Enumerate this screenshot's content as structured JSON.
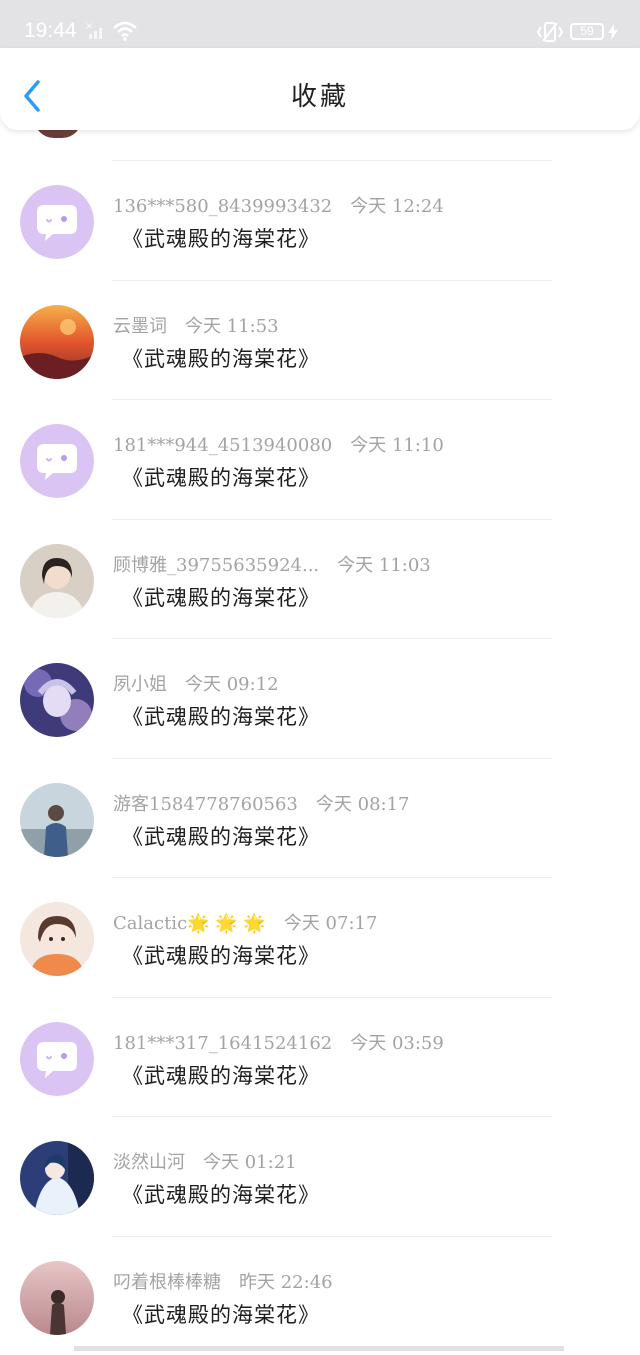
{
  "status_bar": {
    "time": "19:44",
    "battery": "59"
  },
  "header": {
    "title": "收藏"
  },
  "colors": {
    "accent": "#2a9df4",
    "default_avatar": "#d9c4f3",
    "default_avatar_icon": "#ffffff"
  },
  "items": [
    {
      "user": "136***580_8439993432",
      "time": "今天 12:24",
      "comment": "《武魂殿的海棠花》",
      "avatar": "default"
    },
    {
      "user": "云墨词",
      "time": "今天 11:53",
      "comment": "《武魂殿的海棠花》",
      "avatar": "sunset"
    },
    {
      "user": "181***944_4513940080",
      "time": "今天 11:10",
      "comment": "《武魂殿的海棠花》",
      "avatar": "default"
    },
    {
      "user": "顾博雅_39755635924...",
      "time": "今天 11:03",
      "comment": "《武魂殿的海棠花》",
      "avatar": "girl-white"
    },
    {
      "user": "夙小姐",
      "time": "今天 09:12",
      "comment": "《武魂殿的海棠花》",
      "avatar": "anime-purple"
    },
    {
      "user": "游客1584778760563",
      "time": "今天 08:17",
      "comment": "《武魂殿的海棠花》",
      "avatar": "photo-denim"
    },
    {
      "user": "Calactic🌟 🌟 🌟",
      "time": "今天 07:17",
      "comment": "《武魂殿的海棠花》",
      "avatar": "cartoon-girl"
    },
    {
      "user": "181***317_1641524162",
      "time": "今天 03:59",
      "comment": "《武魂殿的海棠花》",
      "avatar": "default"
    },
    {
      "user": "淡然山河",
      "time": "今天 01:21",
      "comment": "《武魂殿的海棠花》",
      "avatar": "anime-blue"
    },
    {
      "user": "叼着根棒棒糖",
      "time": "昨天 22:46",
      "comment": "《武魂殿的海棠花》",
      "avatar": "pink-sky"
    }
  ]
}
